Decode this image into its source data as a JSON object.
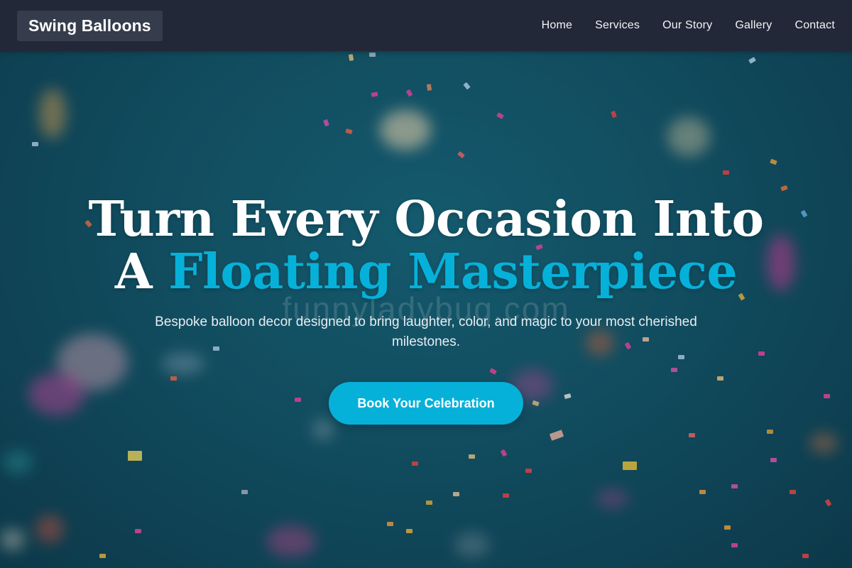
{
  "nav": {
    "brand": "Swing Balloons",
    "links": [
      "Home",
      "Services",
      "Our Story",
      "Gallery",
      "Contact"
    ]
  },
  "hero": {
    "headline_line1": "Turn Every Occasion Into",
    "headline_line2_prefix": "A ",
    "headline_accent": "Floating Masterpiece",
    "subtitle": "Bespoke balloon decor designed to bring laughter, color, and magic to your most cherished milestones.",
    "cta_label": "Book Your Celebration",
    "watermark": "funnyladybug.com"
  },
  "colors": {
    "accent": "#06b1d9",
    "navbar": "#222838",
    "brand_box": "#353c4b",
    "hero_background": "#135568"
  }
}
